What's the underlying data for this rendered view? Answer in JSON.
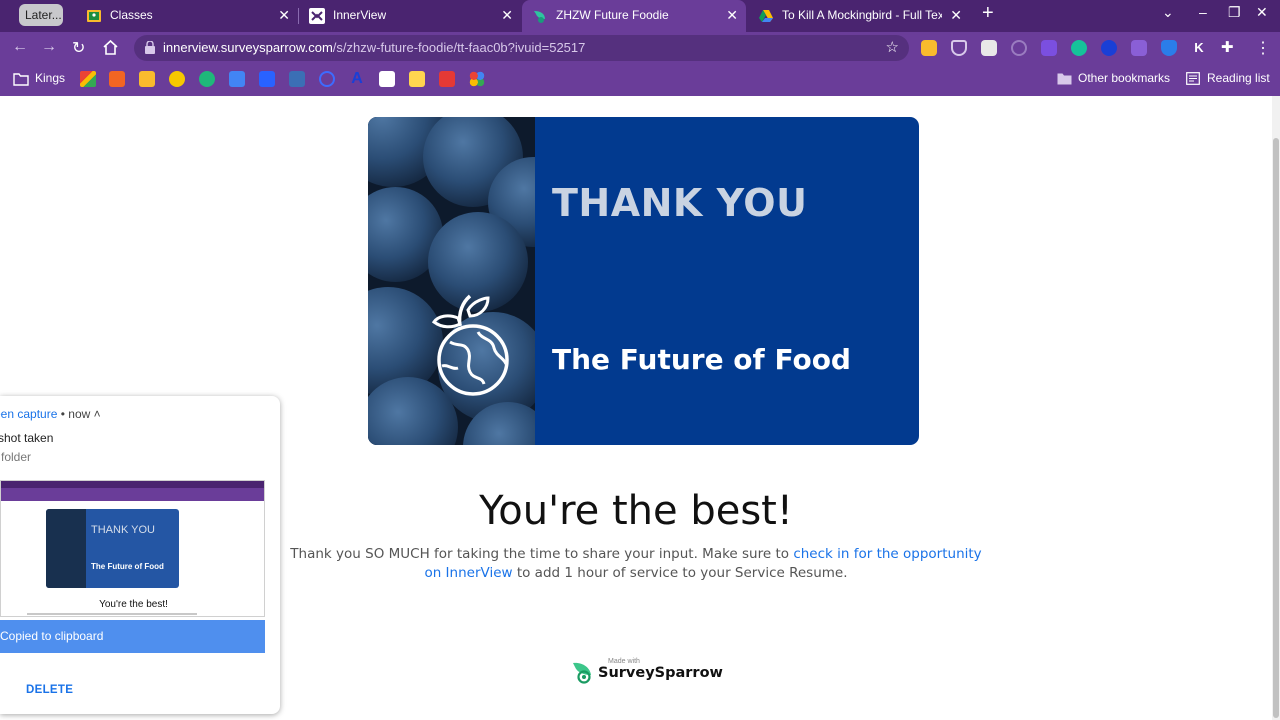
{
  "browser": {
    "tab_group_label": "Later...",
    "tabs": [
      {
        "label": "Classes"
      },
      {
        "label": "InnerView"
      },
      {
        "label": "ZHZW Future Foodie"
      },
      {
        "label": "To Kill A Mockingbird - Full Text f"
      }
    ],
    "url_host": "innerview.surveysparrow.com",
    "url_path": "/s/zhzw-future-foodie/tt-faac0b?ivuid=52517",
    "bookmarks": {
      "kings_label": "Kings",
      "other_bookmarks": "Other bookmarks",
      "reading_list": "Reading list"
    }
  },
  "page": {
    "hero_title": "THANK YOU",
    "hero_subtitle": "The Future of Food",
    "headline": "You're the best!",
    "message_before": "Thank you SO MUCH for taking the time to share your input. Make sure to ",
    "message_link": "check in for the opportunity on InnerView",
    "message_after": " to add 1 hour of service to your Service Resume.",
    "made_with": "Made with",
    "brand": "SurveySparrow"
  },
  "notification": {
    "source": "een capture",
    "time": "now",
    "title": "shot taken",
    "subtitle": "folder",
    "thumb_title": "THANK YOU",
    "thumb_subtitle": "The Future of Food",
    "thumb_headline": "You're the best!",
    "copied_label": "Copied to clipboard",
    "delete_label": "DELETE"
  },
  "colors": {
    "browser_frame": "#6a3d99",
    "tabstrip": "#4a2470",
    "hero_blue": "#023a8f",
    "link_blue": "#1a73e8",
    "notif_bar": "#4f8fee"
  }
}
